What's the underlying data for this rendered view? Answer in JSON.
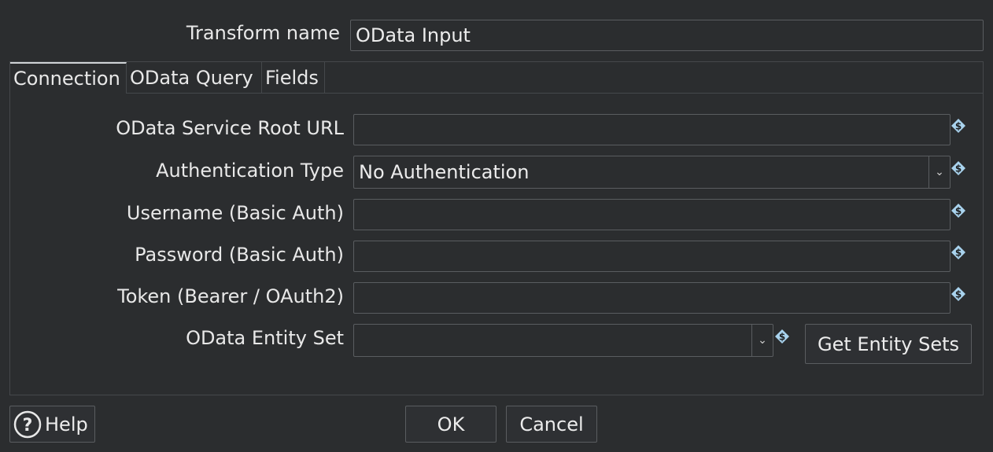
{
  "header": {
    "transform_name_label": "Transform name",
    "transform_name_value": "OData Input"
  },
  "tabs": [
    {
      "label": "Connection",
      "active": true
    },
    {
      "label": "OData Query",
      "active": false
    },
    {
      "label": "Fields",
      "active": false
    }
  ],
  "connection": {
    "service_root_url": {
      "label": "OData Service Root URL",
      "value": ""
    },
    "auth_type": {
      "label": "Authentication Type",
      "value": "No Authentication"
    },
    "username": {
      "label": "Username (Basic Auth)",
      "value": ""
    },
    "password": {
      "label": "Password (Basic Auth)",
      "value": ""
    },
    "token": {
      "label": "Token (Bearer / OAuth2)",
      "value": ""
    },
    "entity_set": {
      "label": "OData Entity Set",
      "value": ""
    },
    "get_entity_sets_label": "Get Entity Sets"
  },
  "footer": {
    "help_label": "Help",
    "ok_label": "OK",
    "cancel_label": "Cancel"
  },
  "icons": {
    "variable": "variable-dollar-diamond-icon",
    "help": "question-circle-icon",
    "dropdown": "chevron-down-icon"
  },
  "colors": {
    "background": "#2b2d2f",
    "border": "#5a5d60",
    "text": "#e8e8e8",
    "variable_icon": "#a9d3ee"
  }
}
